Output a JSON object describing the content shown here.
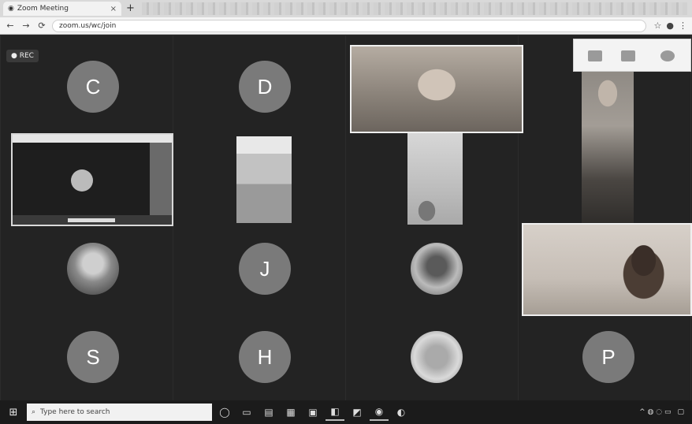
{
  "browser": {
    "tab_title": "Zoom Meeting",
    "new_tab_symbol": "+",
    "tab_close_symbol": "×",
    "url": "zoom.us/wc/join",
    "nav": {
      "back": "←",
      "forward": "→",
      "reload": "⟳"
    }
  },
  "meeting": {
    "rec_label": "● REC",
    "participants": [
      {
        "id": "c",
        "initial": "C"
      },
      {
        "id": "d",
        "initial": "D"
      },
      {
        "id": "j",
        "initial": "J"
      },
      {
        "id": "s",
        "initial": "S"
      },
      {
        "id": "h",
        "initial": "H"
      },
      {
        "id": "p",
        "initial": "P"
      }
    ]
  },
  "taskbar": {
    "start_symbol": "⊞",
    "search_placeholder": "Type here to search",
    "app_symbols": [
      "◯",
      "▭",
      "▤",
      "▦",
      "▣",
      "◧",
      "◩",
      "◉",
      "◐"
    ],
    "tray_text": "^  ◍  ◌  ▭"
  },
  "colors": {
    "meeting_bg": "#232323",
    "avatar_gray": "#7a7a7a",
    "taskbar_bg": "#1b1b1b"
  }
}
